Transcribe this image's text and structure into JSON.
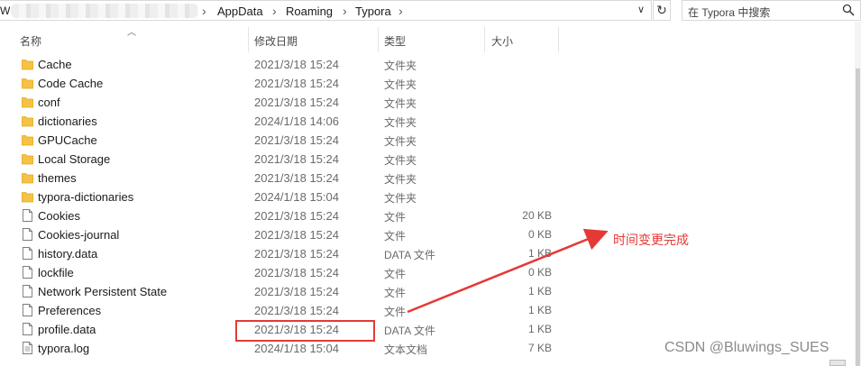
{
  "address": {
    "lead_char": "W",
    "crumbs": [
      "AppData",
      "Roaming",
      "Typora"
    ]
  },
  "search": {
    "placeholder": "在 Typora 中搜索"
  },
  "columns": {
    "name": "名称",
    "date": "修改日期",
    "type": "类型",
    "size": "大小"
  },
  "files": [
    {
      "name": "Cache",
      "date": "2021/3/18 15:24",
      "type": "文件夹",
      "size": "",
      "kind": "folder"
    },
    {
      "name": "Code Cache",
      "date": "2021/3/18 15:24",
      "type": "文件夹",
      "size": "",
      "kind": "folder"
    },
    {
      "name": "conf",
      "date": "2021/3/18 15:24",
      "type": "文件夹",
      "size": "",
      "kind": "folder"
    },
    {
      "name": "dictionaries",
      "date": "2024/1/18 14:06",
      "type": "文件夹",
      "size": "",
      "kind": "folder"
    },
    {
      "name": "GPUCache",
      "date": "2021/3/18 15:24",
      "type": "文件夹",
      "size": "",
      "kind": "folder"
    },
    {
      "name": "Local Storage",
      "date": "2021/3/18 15:24",
      "type": "文件夹",
      "size": "",
      "kind": "folder"
    },
    {
      "name": "themes",
      "date": "2021/3/18 15:24",
      "type": "文件夹",
      "size": "",
      "kind": "folder"
    },
    {
      "name": "typora-dictionaries",
      "date": "2024/1/18 15:04",
      "type": "文件夹",
      "size": "",
      "kind": "folder"
    },
    {
      "name": "Cookies",
      "date": "2021/3/18 15:24",
      "type": "文件",
      "size": "20 KB",
      "kind": "file"
    },
    {
      "name": "Cookies-journal",
      "date": "2021/3/18 15:24",
      "type": "文件",
      "size": "0 KB",
      "kind": "file"
    },
    {
      "name": "history.data",
      "date": "2021/3/18 15:24",
      "type": "DATA 文件",
      "size": "1 KB",
      "kind": "file"
    },
    {
      "name": "lockfile",
      "date": "2021/3/18 15:24",
      "type": "文件",
      "size": "0 KB",
      "kind": "file"
    },
    {
      "name": "Network Persistent State",
      "date": "2021/3/18 15:24",
      "type": "文件",
      "size": "1 KB",
      "kind": "file"
    },
    {
      "name": "Preferences",
      "date": "2021/3/18 15:24",
      "type": "文件",
      "size": "1 KB",
      "kind": "file"
    },
    {
      "name": "profile.data",
      "date": "2021/3/18 15:24",
      "type": "DATA 文件",
      "size": "1 KB",
      "kind": "file"
    },
    {
      "name": "typora.log",
      "date": "2024/1/18 15:04",
      "type": "文本文档",
      "size": "7 KB",
      "kind": "textfile"
    }
  ],
  "annotation": {
    "note": "时间变更完成",
    "color": "#e53935"
  },
  "watermark": "CSDN @Bluwings_SUES",
  "colors": {
    "folder": "#f6c244",
    "folder_dark": "#e2a918",
    "accent_red": "#e53935"
  }
}
